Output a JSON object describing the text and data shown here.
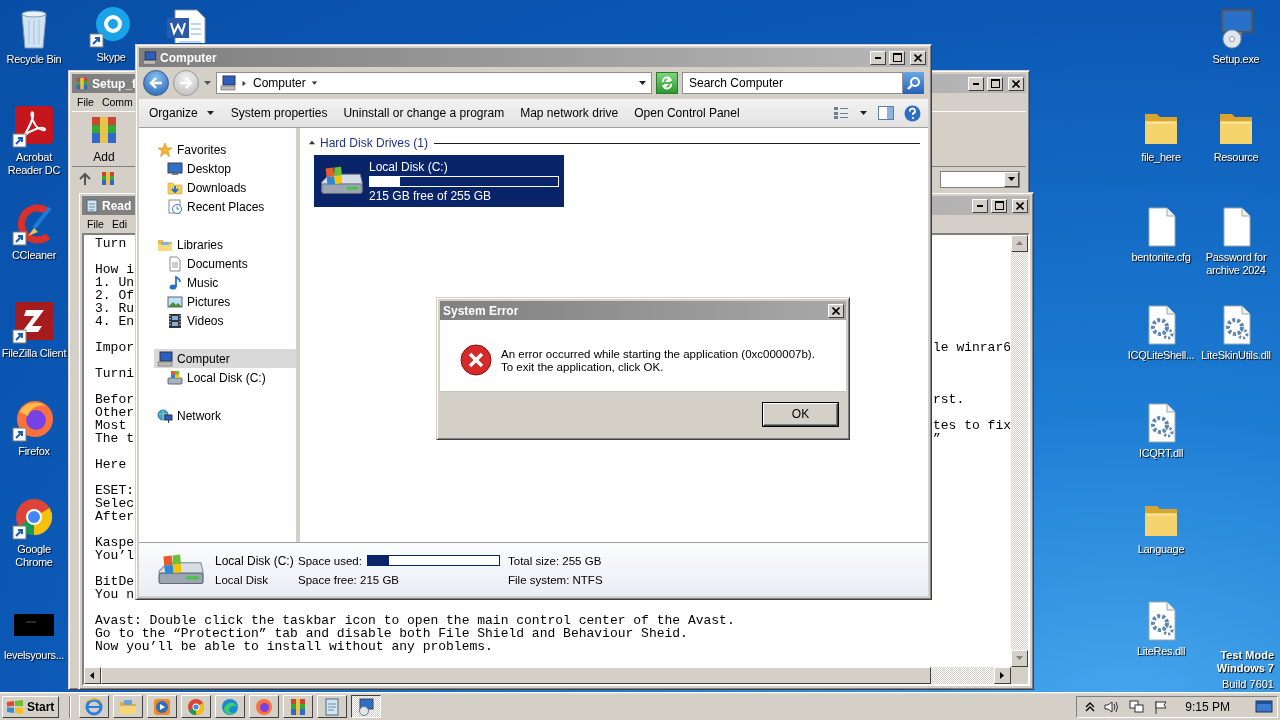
{
  "desktop": {
    "left_icons": [
      {
        "label": "Recycle Bin",
        "shortcut": false
      },
      {
        "label": "Skype",
        "shortcut": true
      },
      {
        "label": "Acrobat Reader DC",
        "shortcut": true
      },
      {
        "label": "CCleaner",
        "shortcut": true
      },
      {
        "label": "FileZilla Client",
        "shortcut": true
      },
      {
        "label": "Firefox",
        "shortcut": true
      },
      {
        "label": "Google Chrome",
        "shortcut": true
      },
      {
        "label": "levelsyours...",
        "shortcut": false
      }
    ],
    "right_icons": [
      {
        "label": "Setup.exe",
        "shortcut": false
      },
      {
        "label": "file_here",
        "shortcut": false
      },
      {
        "label": "Resource",
        "shortcut": false
      },
      {
        "label": "bentonite.cfg",
        "shortcut": false
      },
      {
        "label": "Password for archive 2024",
        "shortcut": false
      },
      {
        "label": "ICQLiteShell...",
        "shortcut": false
      },
      {
        "label": "LiteSkinUtils.dll",
        "shortcut": false
      },
      {
        "label": "ICQRT.dll",
        "shortcut": false
      },
      {
        "label": "Language",
        "shortcut": false
      },
      {
        "label": "LiteRes.dll",
        "shortcut": false
      }
    ],
    "notice": [
      "Test Mode",
      "Windows 7",
      "Build 7601"
    ]
  },
  "setup_window": {
    "title": "Setup_f",
    "menu": [
      "File",
      "Comm"
    ],
    "toolbar": [
      "Add"
    ]
  },
  "notepad": {
    "title": "Read",
    "menu": [
      "File",
      "Edi"
    ],
    "paragraphs": [
      [
        {
          "text": "Turn"
        }
      ],
      [
        {
          "text": "How i"
        },
        {
          "text": "1. Un"
        },
        {
          "text": "2. Of"
        },
        {
          "text": "3. Ru"
        },
        {
          "text": "4. En"
        }
      ],
      [
        {
          "text": "Impor",
          "tail": "le winrar6"
        }
      ],
      [
        {
          "text": "Turni"
        }
      ],
      [
        {
          "text": "Befor",
          "tail": "rst."
        },
        {
          "text": "Other"
        },
        {
          "text": "Most",
          "tail": "tes to fix"
        },
        {
          "text": "The t",
          "tail": "”"
        }
      ],
      [
        {
          "text": "Here"
        }
      ],
      [
        {
          "text": "ESET:"
        },
        {
          "text": "Selec"
        },
        {
          "text": "After"
        }
      ],
      [
        {
          "text": "Kaspe"
        },
        {
          "text": "You’l"
        }
      ],
      [
        {
          "text": "BitDe"
        },
        {
          "text": "You n"
        }
      ],
      [
        {
          "text": "Avast: Double click the taskbar icon to open the main control center of the Avast."
        },
        {
          "text": "Go to the “Protection” tab and disable both File Shield and Behaviour Sheid."
        },
        {
          "text": "Now you’ll be able to install without any problems."
        }
      ]
    ]
  },
  "explorer": {
    "title": "Computer",
    "breadcrumb": "Computer",
    "search": {
      "placeholder": "Search Computer"
    },
    "toolbar": [
      {
        "label": "Organize",
        "dropdown": true
      },
      {
        "label": "System properties",
        "dropdown": false
      },
      {
        "label": "Uninstall or change a program",
        "dropdown": false
      },
      {
        "label": "Map network drive",
        "dropdown": false
      },
      {
        "label": "Open Control Panel",
        "dropdown": false
      }
    ],
    "nav": [
      {
        "label": "Favorites",
        "selected": false,
        "children": [
          {
            "label": "Desktop",
            "selected": false
          },
          {
            "label": "Downloads",
            "selected": false
          },
          {
            "label": "Recent Places",
            "selected": false
          }
        ]
      },
      {
        "label": "Libraries",
        "selected": false,
        "children": [
          {
            "label": "Documents",
            "selected": false
          },
          {
            "label": "Music",
            "selected": false
          },
          {
            "label": "Pictures",
            "selected": false
          },
          {
            "label": "Videos",
            "selected": false
          }
        ]
      },
      {
        "label": "Computer",
        "selected": true,
        "children": [
          {
            "label": "Local Disk (C:)",
            "selected": false
          }
        ]
      },
      {
        "label": "Network",
        "selected": false
      }
    ],
    "group": {
      "label": "Hard Disk Drives (1)",
      "expanded": true
    },
    "drives": [
      {
        "name": "Local Disk (C:)",
        "level": 0.16,
        "free": "215 GB free of 255 GB",
        "selected": true
      }
    ],
    "details": {
      "name": "Local Disk (C:)",
      "type": "Local Disk",
      "used_label": "Space used:",
      "level": 0.16,
      "free": "Space free: 215 GB",
      "total": "Total size: 255 GB",
      "file_system": "File system: NTFS"
    }
  },
  "dialog": {
    "title": "System Error",
    "message": "An error occurred while starting the application (0xc000007b). To exit the application, click OK.",
    "button": "OK"
  },
  "taskbar": {
    "start": "Start",
    "apps": [
      {
        "active": false
      },
      {
        "active": false
      },
      {
        "active": false
      },
      {
        "active": false
      },
      {
        "active": false
      },
      {
        "active": false
      },
      {
        "active": false
      },
      {
        "active": false
      },
      {
        "active": true
      }
    ],
    "time": "9:15 PM"
  }
}
